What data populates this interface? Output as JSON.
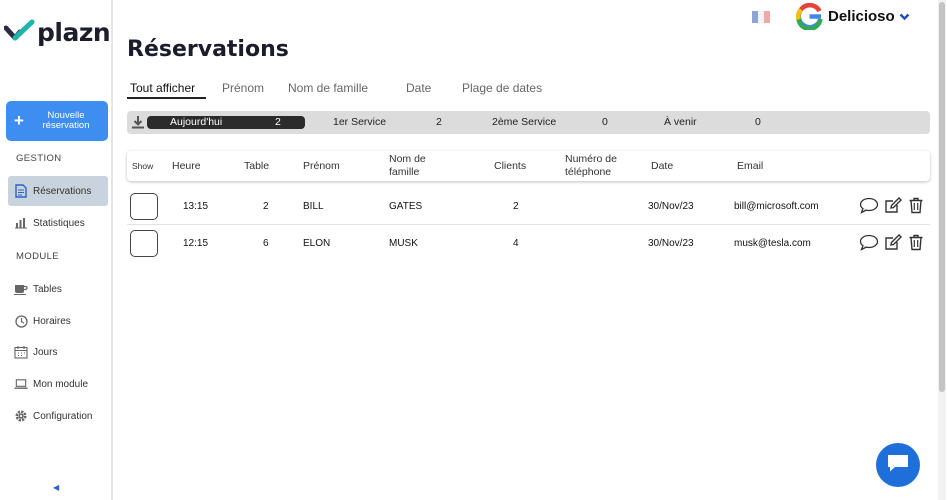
{
  "brand": {
    "logo_text": "plazn",
    "accent": "#3d8ef0"
  },
  "sidebar": {
    "new_reservation": "Nouvelle réservation",
    "section_gestion": "GESTION",
    "section_module": "MODULE",
    "items": [
      {
        "label": "Réservations",
        "icon": "document-icon",
        "active": true
      },
      {
        "label": "Statistiques",
        "icon": "bar-chart-icon"
      },
      {
        "label": "Tables",
        "icon": "coffee-cup-icon"
      },
      {
        "label": "Horaires",
        "icon": "clock-icon"
      },
      {
        "label": "Jours",
        "icon": "calendar-icon"
      },
      {
        "label": "Mon module",
        "icon": "laptop-icon"
      },
      {
        "label": "Configuration",
        "icon": "gear-icon"
      }
    ]
  },
  "header": {
    "restaurant": "Delicioso",
    "language": "fr"
  },
  "page_title": "Réservations",
  "tabs": [
    "Tout afficher",
    "Prénom",
    "Nom de famille",
    "Date",
    "Plage de dates"
  ],
  "stats": {
    "today_label": "Aujourd'hui",
    "today_value": "2",
    "service1_label": "1er Service",
    "service1_value": "2",
    "service2_label": "2ème Service",
    "service2_value": "0",
    "upcoming_label": "À venir",
    "upcoming_value": "0"
  },
  "table": {
    "headers": {
      "show": "Show",
      "heure": "Heure",
      "table": "Table",
      "prenom": "Prénom",
      "nom": "Nom de famille",
      "clients": "Clients",
      "telephone": "Numéro de téléphone",
      "date": "Date",
      "email": "Email"
    },
    "rows": [
      {
        "heure": "13:15",
        "table": "2",
        "prenom": "BILL",
        "nom": "GATES",
        "clients": "2",
        "telephone": "",
        "date": "30/Nov/23",
        "email": "bill@microsoft.com"
      },
      {
        "heure": "12:15",
        "table": "6",
        "prenom": "ELON",
        "nom": "MUSK",
        "clients": "4",
        "telephone": "",
        "date": "30/Nov/23",
        "email": "musk@tesla.com"
      }
    ]
  }
}
